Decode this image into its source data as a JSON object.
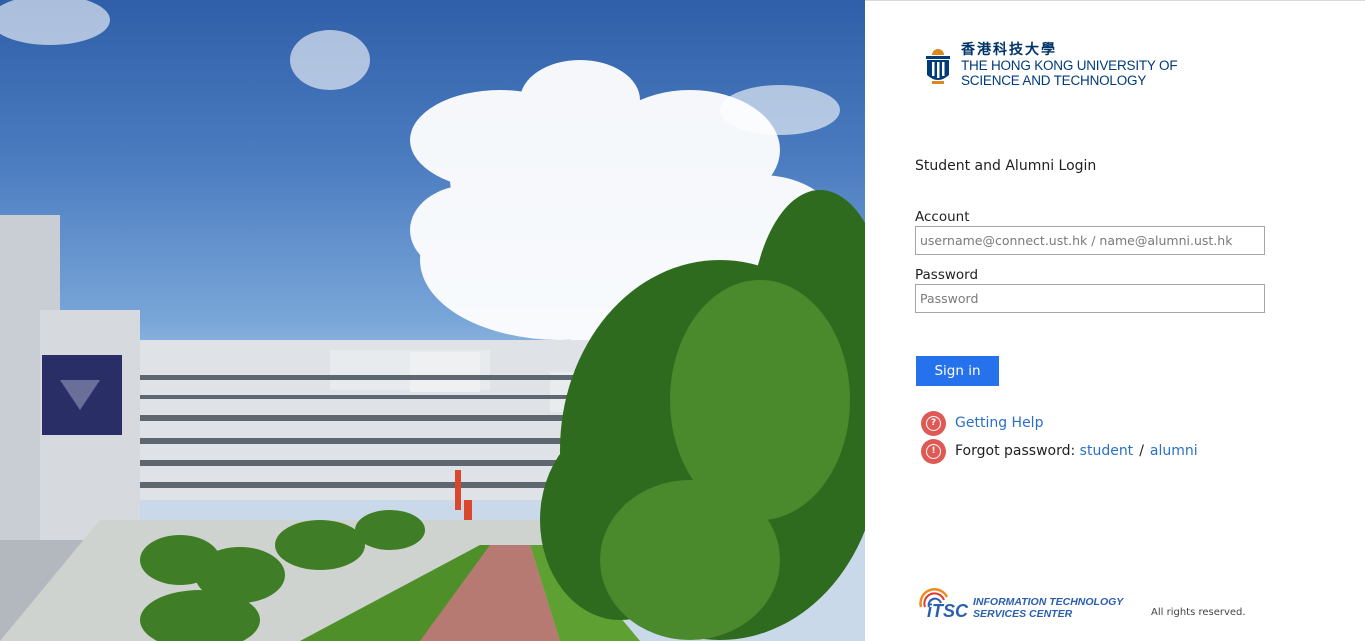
{
  "logo": {
    "chinese_name": "香港科技大學",
    "english_line1": "THE HONG KONG UNIVERSITY OF",
    "english_line2": "SCIENCE AND TECHNOLOGY"
  },
  "login": {
    "heading": "Student and Alumni Login",
    "account_label": "Account",
    "account_placeholder": "username@connect.ust.hk / name@alumni.ust.hk",
    "account_value": "",
    "password_label": "Password",
    "password_placeholder": "Password",
    "password_value": "",
    "signin_label": "Sign in"
  },
  "help": {
    "getting_help": "Getting Help",
    "forgot_prefix": "Forgot password: ",
    "student_link": "student",
    "separator": "/",
    "alumni_link": "alumni"
  },
  "footer": {
    "itsc_line1": "INFORMATION TECHNOLOGY",
    "itsc_line2": "SERVICES CENTER",
    "rights": "All rights reserved."
  },
  "colors": {
    "accent": "#2672ec",
    "link": "#2a6fc9",
    "help_icon": "#e05a55",
    "brand": "#003b7a"
  },
  "icons": {
    "hero": "campus-photo",
    "logo": "hkust-emblem-icon",
    "help": "question-circle-icon",
    "forgot": "exclamation-circle-icon",
    "itsc": "itsc-logo-icon"
  }
}
